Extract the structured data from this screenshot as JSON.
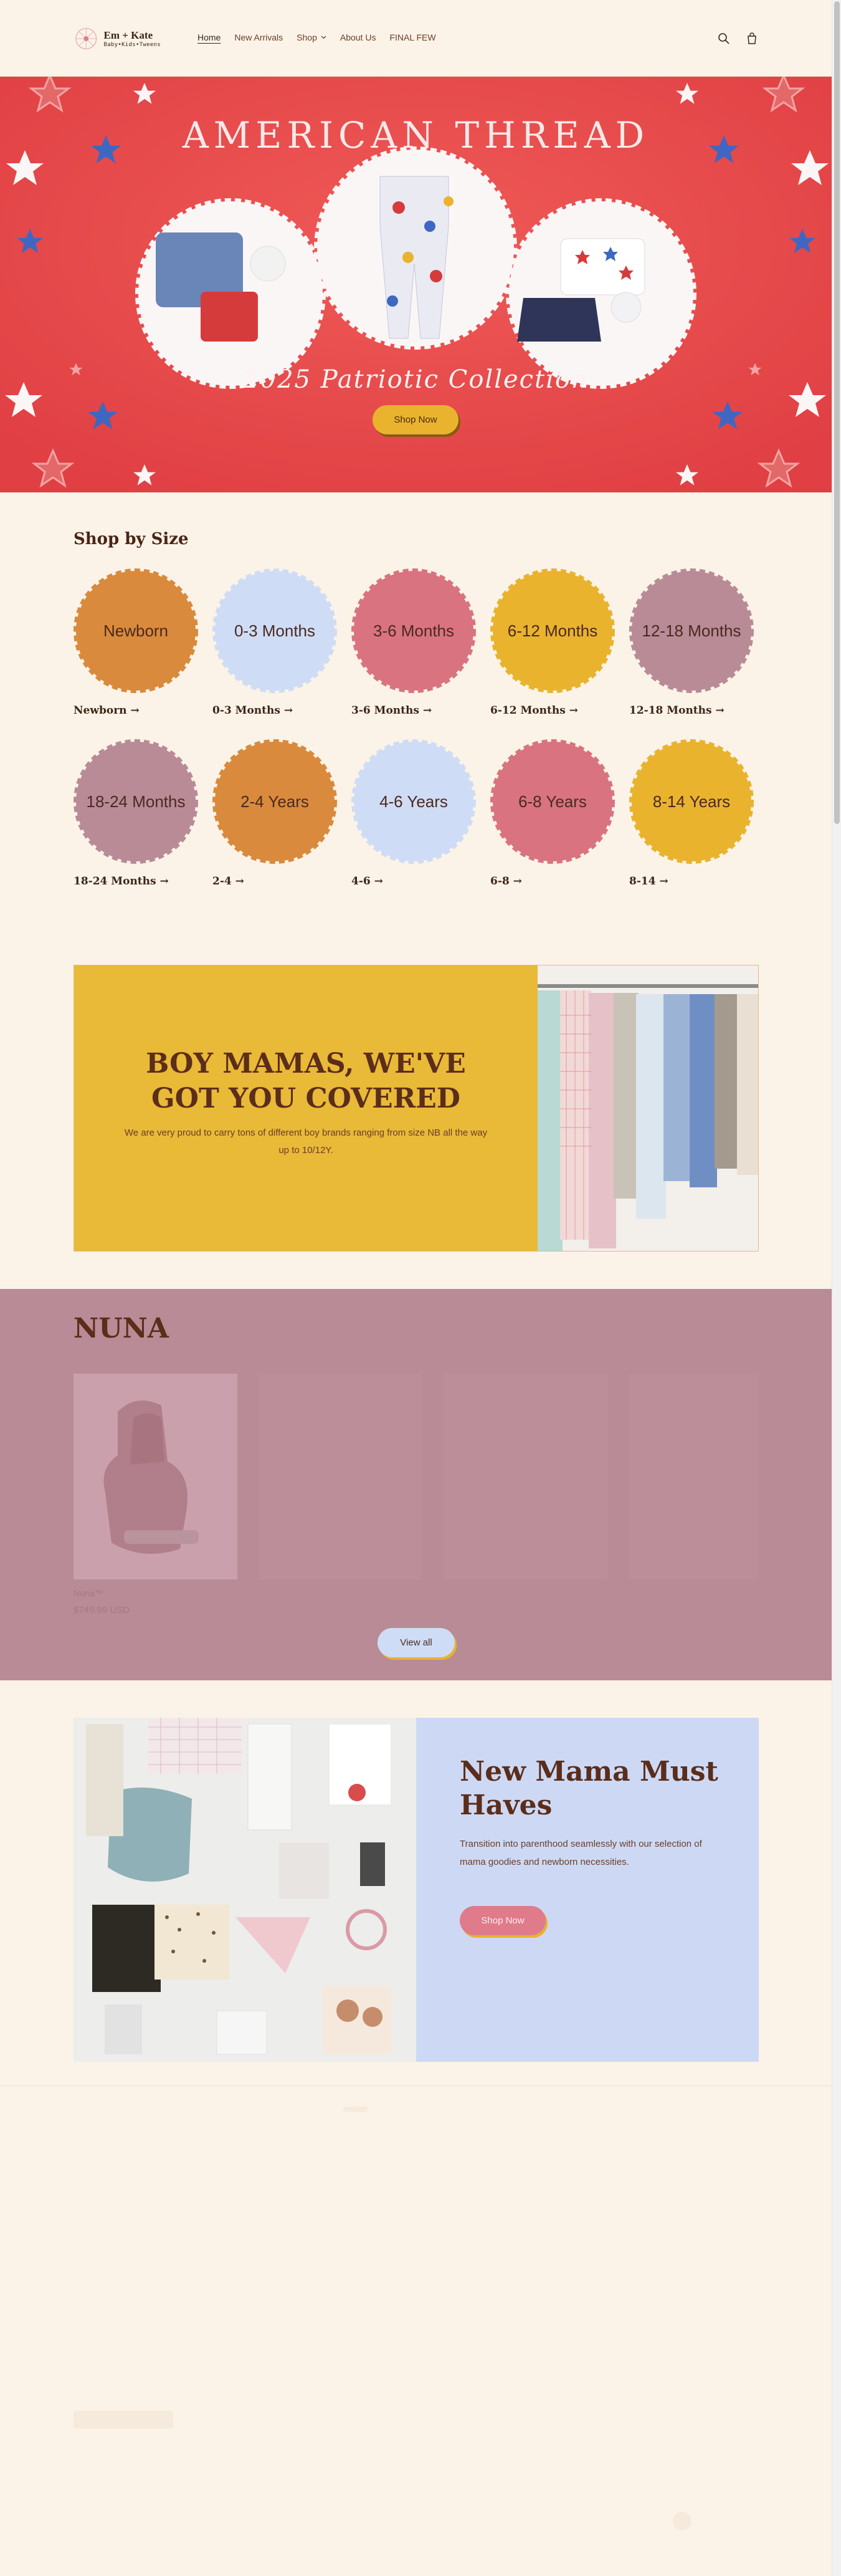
{
  "brand": {
    "name": "Em + Kate",
    "tagline": "Baby•Kids•Tweens"
  },
  "nav": {
    "items": [
      {
        "label": "Home",
        "active": true
      },
      {
        "label": "New Arrivals",
        "active": false
      },
      {
        "label": "Shop",
        "active": false,
        "dropdown": true
      },
      {
        "label": "About Us",
        "active": false
      },
      {
        "label": "FINAL FEW",
        "active": false
      }
    ],
    "icons": [
      "search-icon",
      "cart-icon"
    ]
  },
  "hero": {
    "title": "AMERICAN THREAD",
    "subtitle": "2025 Patriotic Collection",
    "button": "Shop Now"
  },
  "shop_by_size": {
    "title": "Shop by Size",
    "items": [
      {
        "circle": "Newborn",
        "link": "Newborn →",
        "color": "#d98a3c"
      },
      {
        "circle": "0-3 Months",
        "link": "0-3 Months →",
        "color": "#cfdcf6"
      },
      {
        "circle": "3-6 Months",
        "link": "3-6 Months →",
        "color": "#d9737f"
      },
      {
        "circle": "6-12 Months",
        "link": "6-12 Months →",
        "color": "#e9b32e"
      },
      {
        "circle": "12-18 Months",
        "link": "12-18 Months →",
        "color": "#b88b96"
      },
      {
        "circle": "18-24 Months",
        "link": "18-24 Months →",
        "color": "#b88b96"
      },
      {
        "circle": "2-4 Years",
        "link": "2-4 →",
        "color": "#d98a3c"
      },
      {
        "circle": "4-6 Years",
        "link": "4-6 →",
        "color": "#cfdcf6"
      },
      {
        "circle": "6-8 Years",
        "link": "6-8 →",
        "color": "#d9737f"
      },
      {
        "circle": "8-14 Years",
        "link": "8-14 →",
        "color": "#e9b32e"
      }
    ]
  },
  "boy_mamas": {
    "title_line1": "BOY MAMAS, WE'VE",
    "title_line2": "GOT YOU COVERED",
    "body": "We are very proud to carry tons of different boy brands ranging from size NB all the way up to 10/12Y."
  },
  "nuna": {
    "title": "NUNA",
    "product": {
      "name": "Nuna™",
      "price": "$749.99 USD"
    },
    "view_all": "View all"
  },
  "new_mama": {
    "title": "New Mama Must Haves",
    "body": "Transition into parenthood seamlessly with our selection of mama goodies and newborn necessities.",
    "button": "Shop Now"
  },
  "colors": {
    "background": "#fbf3e7",
    "hero_red": "#e84a4a",
    "mustard": "#e9b32e",
    "mauve": "#b88b96",
    "periwinkle": "#cdd9f4",
    "brown_text": "#5b2d1a"
  }
}
